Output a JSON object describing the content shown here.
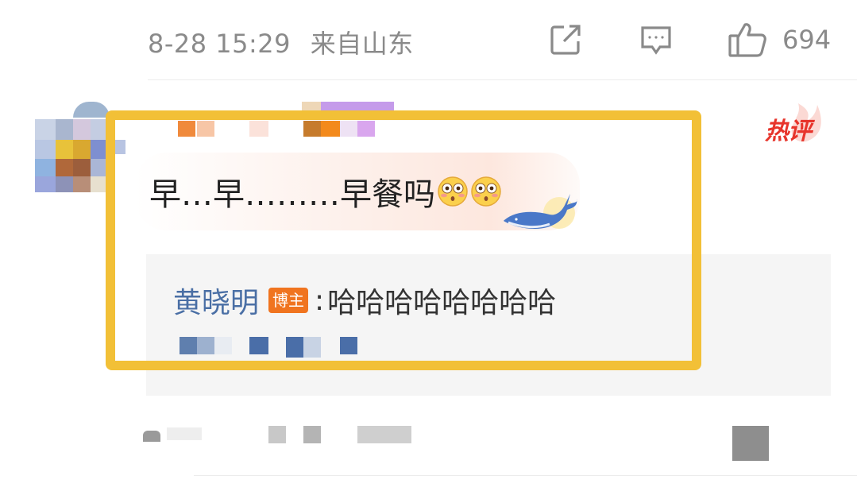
{
  "post_meta": {
    "timestamp": "8-28 15:29",
    "location": "来自山东",
    "like_count": "694"
  },
  "comment": {
    "hot_badge": "热评",
    "text": "早…早………早餐吗"
  },
  "reply": {
    "author": "黄晓明",
    "badge": "博主",
    "colon": ":",
    "text": "哈哈哈哈哈哈哈哈"
  },
  "icons": {
    "share": "share-icon",
    "comment": "comment-icon",
    "like": "thumbs-up-icon",
    "emoji": "flushed-face-emoji",
    "whale": "whale-decoration",
    "hot": "hot-comment-badge"
  },
  "colors": {
    "highlight_frame": "#f2c037",
    "hot_badge": "#e7342b",
    "reply_author": "#4a6fa5",
    "blogger_badge": "#f0741f",
    "meta_gray": "#8a8a8a"
  }
}
